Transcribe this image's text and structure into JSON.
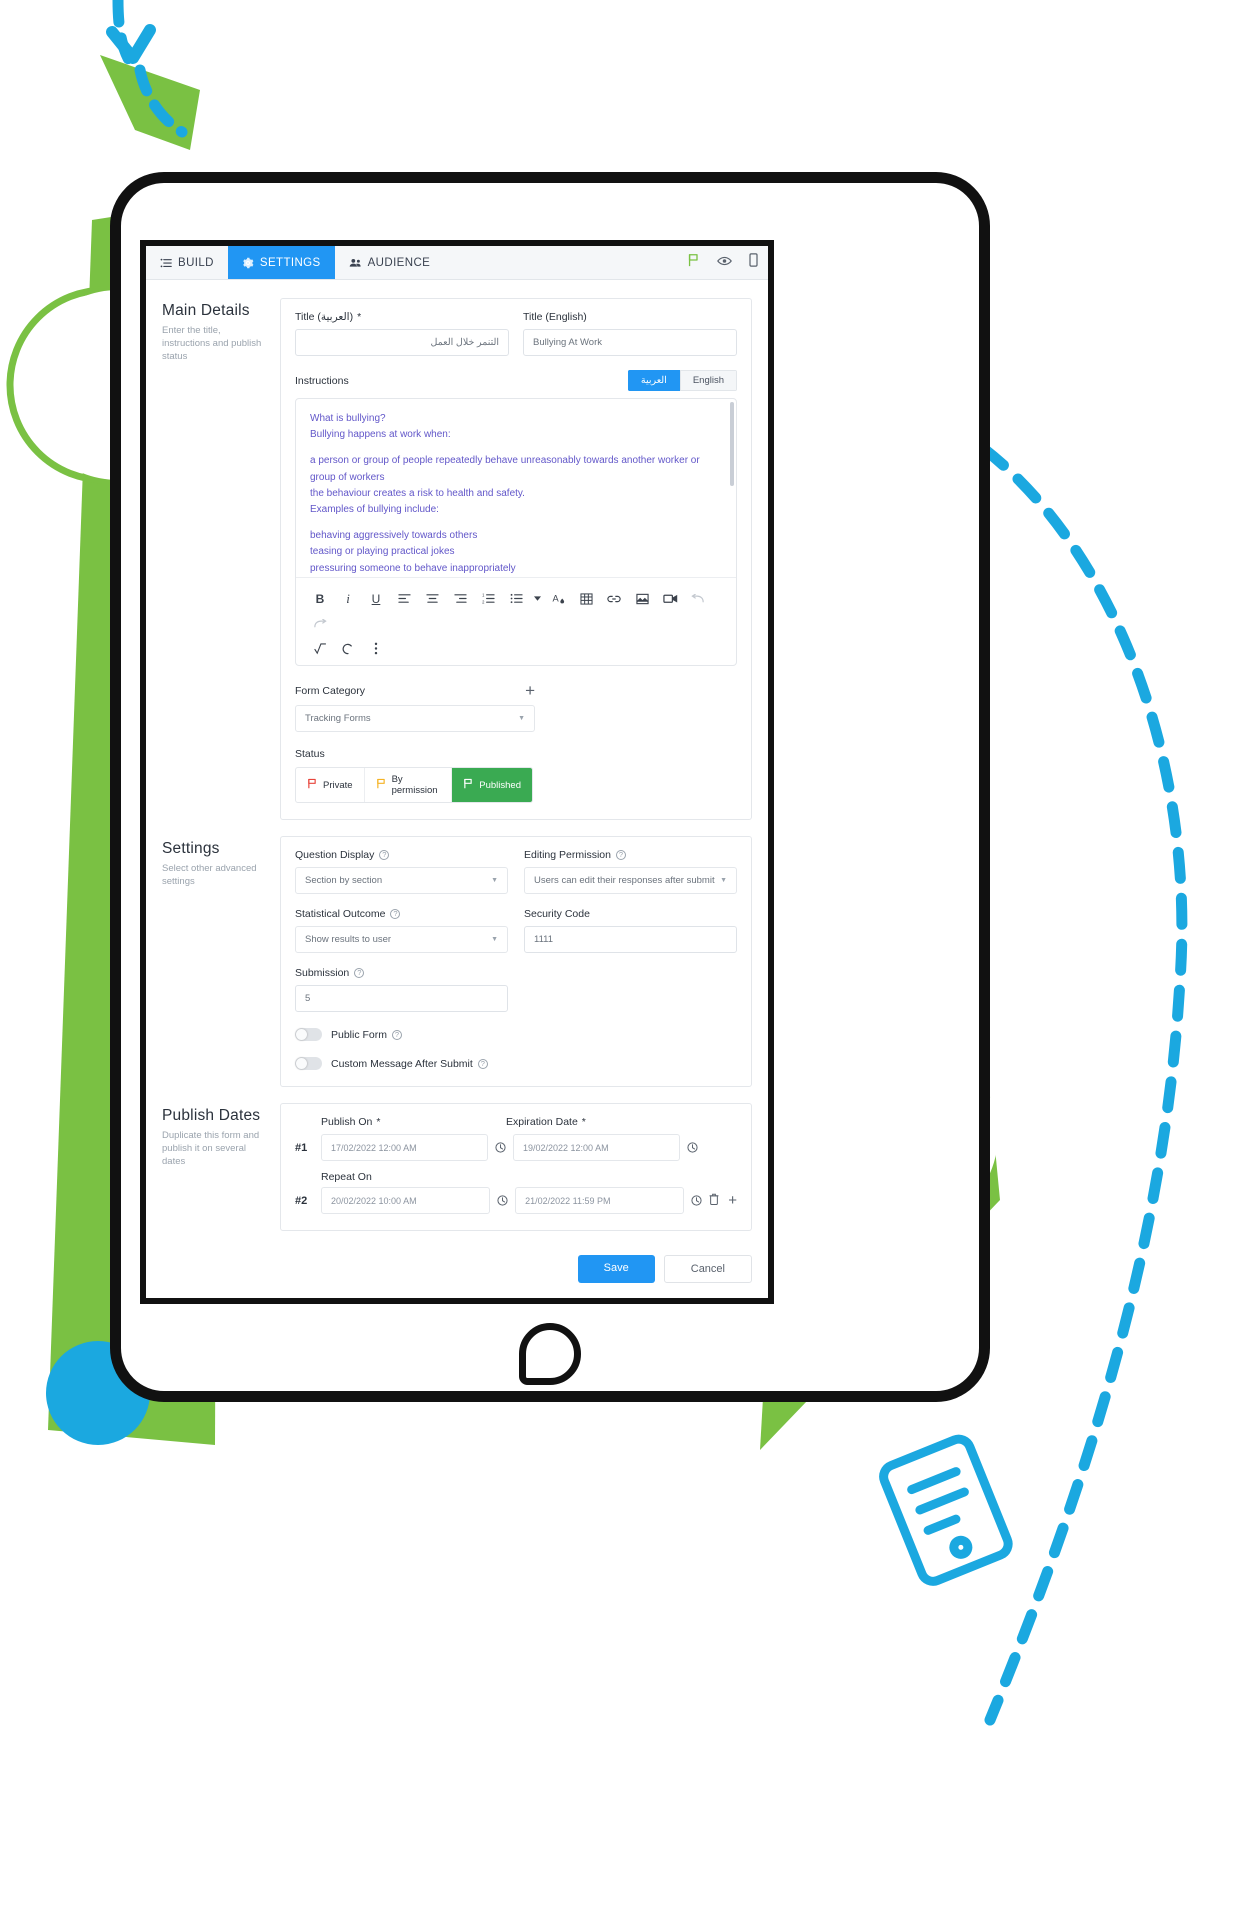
{
  "tabs": [
    {
      "label": "BUILD",
      "icon": "list-icon",
      "active": false
    },
    {
      "label": "SETTINGS",
      "icon": "gear-icon",
      "active": true
    },
    {
      "label": "AUDIENCE",
      "icon": "people-icon",
      "active": false
    }
  ],
  "toolbar_icons": [
    "flag-icon",
    "eye-icon",
    "mobile-icon"
  ],
  "main_details": {
    "title": "Main Details",
    "subtitle": "Enter the title, instructions and publish status",
    "title_ar_label": "Title (العربية)",
    "title_ar_required": "*",
    "title_ar_value": "التنمر خلال العمل",
    "title_en_label": "Title (English)",
    "title_en_value": "Bullying At Work",
    "instructions_label": "Instructions",
    "lang_toggle": [
      {
        "label": "العربية",
        "active": true
      },
      {
        "label": "English",
        "active": false
      }
    ],
    "instructions_lines": [
      "What is bullying?",
      "Bullying happens at work when:",
      "",
      "a person or group of people repeatedly behave unreasonably towards another worker or group of workers",
      "the behaviour creates a risk to health and safety.",
      "Examples of bullying include:",
      "",
      "behaving aggressively towards others",
      "teasing or playing practical jokes",
      "pressuring someone to behave inappropriately"
    ],
    "editor_tools": [
      "bold-icon",
      "italic-icon",
      "underline-icon",
      "align-left-icon",
      "align-center-icon",
      "align-right-icon",
      "ordered-list-icon",
      "unordered-list-icon",
      "chevron-down-icon",
      "text-color-icon",
      "table-icon",
      "link-icon",
      "image-icon",
      "video-icon",
      "undo-icon",
      "redo-icon",
      "formula-icon",
      "clear-format-icon",
      "more-icon"
    ],
    "form_category_label": "Form Category",
    "form_category_add": "+",
    "form_category_value": "Tracking Forms",
    "status_label": "Status",
    "status_options": [
      {
        "label": "Private",
        "icon": "flag-icon",
        "color": "#e8453c",
        "active": false
      },
      {
        "label": "By permission",
        "icon": "flag-icon",
        "color": "#f5b325",
        "active": false
      },
      {
        "label": "Published",
        "icon": "flag-icon",
        "color": "#ffffff",
        "active": true
      }
    ]
  },
  "settings": {
    "title": "Settings",
    "subtitle": "Select other advanced settings",
    "question_display_label": "Question Display",
    "question_display_value": "Section by section",
    "editing_permission_label": "Editing Permission",
    "editing_permission_value": "Users can edit their responses after submit",
    "statistical_outcome_label": "Statistical Outcome",
    "statistical_outcome_value": "Show results to user",
    "security_code_label": "Security Code",
    "security_code_value": "1111",
    "submission_label": "Submission",
    "submission_value": "5",
    "public_form_label": "Public Form",
    "public_form_on": false,
    "custom_message_label": "Custom Message After Submit",
    "custom_message_on": false
  },
  "publish_dates": {
    "title": "Publish Dates",
    "subtitle": "Duplicate this form and publish it on several dates",
    "publish_on_label": "Publish On",
    "publish_on_required": "*",
    "expiration_label": "Expiration Date",
    "expiration_required": "*",
    "repeat_on_label": "Repeat On",
    "rows": [
      {
        "num": "#1",
        "publish_on": "17/02/2022 12:00 AM",
        "expiration": "19/02/2022 12:00 AM"
      },
      {
        "num": "#2",
        "publish_on": "20/02/2022 10:00 AM",
        "expiration": "21/02/2022 11:59 PM"
      }
    ]
  },
  "footer": {
    "save_label": "Save",
    "cancel_label": "Cancel"
  },
  "colors": {
    "accent_blue": "#2196f3",
    "green": "#3aaa52",
    "deco_green": "#7ac143",
    "deco_blue": "#1ba8e0",
    "instructions_text": "#6257c9"
  }
}
